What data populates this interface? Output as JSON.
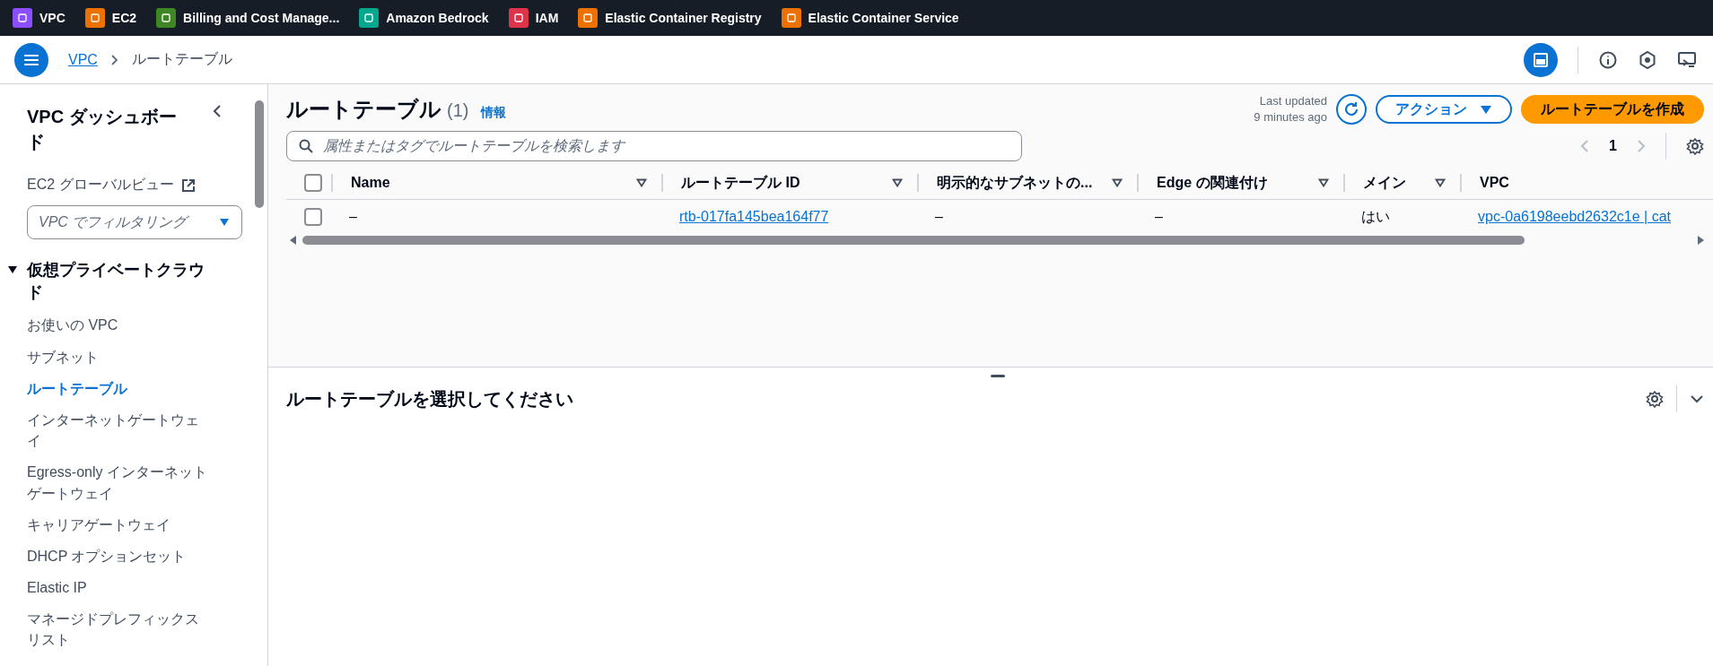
{
  "favorites": [
    {
      "label": "VPC",
      "color": "#8c4fff"
    },
    {
      "label": "EC2",
      "color": "#ed7100"
    },
    {
      "label": "Billing and Cost Manage...",
      "color": "#3f8624"
    },
    {
      "label": "Amazon Bedrock",
      "color": "#01a88d"
    },
    {
      "label": "IAM",
      "color": "#dd344c"
    },
    {
      "label": "Elastic Container Registry",
      "color": "#ed7100"
    },
    {
      "label": "Elastic Container Service",
      "color": "#ed7100"
    }
  ],
  "breadcrumb": [
    {
      "label": "VPC",
      "kind": "link"
    },
    {
      "label": "ルートテーブル",
      "kind": "current"
    }
  ],
  "sidebar": {
    "title": "VPC ダッシュボード",
    "global_view": "EC2 グローバルビュー",
    "filter": {
      "placeholder": "VPC でフィルタリング"
    },
    "section": {
      "label": "仮想プライベートクラウド",
      "expanded": true,
      "items": [
        {
          "label": "お使いの VPC",
          "selected": false
        },
        {
          "label": "サブネット",
          "selected": false
        },
        {
          "label": "ルートテーブル",
          "selected": true
        },
        {
          "label": "インターネットゲートウェイ",
          "selected": false
        },
        {
          "label": "Egress-only インターネットゲートウェイ",
          "selected": false
        },
        {
          "label": "キャリアゲートウェイ",
          "selected": false
        },
        {
          "label": "DHCP オプションセット",
          "selected": false
        },
        {
          "label": "Elastic IP",
          "selected": false
        },
        {
          "label": "マネージドプレフィックスリスト",
          "selected": false
        }
      ]
    }
  },
  "panel": {
    "title": "ルートテーブル",
    "count": "(1)",
    "info": "情報",
    "last_updated": [
      "Last updated",
      "9 minutes ago"
    ],
    "actions_button": "アクション",
    "create_button": "ルートテーブルを作成",
    "search": {
      "placeholder": "属性またはタグでルートテーブルを検索します"
    },
    "page": "1",
    "table": {
      "select_all": {
        "checked": false
      },
      "columns": [
        "Name",
        "ルートテーブル ID",
        "明示的なサブネットの...",
        "Edge の関連付け",
        "メイン",
        "VPC"
      ],
      "rows": [
        {
          "checked": false,
          "cells": [
            {
              "text": "–",
              "kind": "text"
            },
            {
              "text": "rtb-017fa145bea164f77",
              "kind": "link"
            },
            {
              "text": "–",
              "kind": "text"
            },
            {
              "text": "–",
              "kind": "text"
            },
            {
              "text": "はい",
              "kind": "text"
            },
            {
              "text": "vpc-0a6198eebd2632c1e | cat",
              "kind": "link"
            }
          ]
        }
      ]
    }
  },
  "detail": {
    "title": "ルートテーブルを選択してください"
  }
}
